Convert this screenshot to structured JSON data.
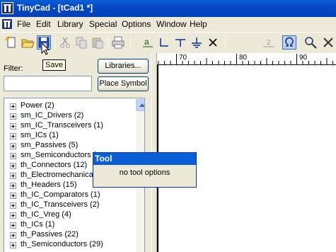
{
  "window": {
    "title": "TinyCad - [tCad1 *]"
  },
  "menu": {
    "items": [
      "File",
      "Edit",
      "Library",
      "Special",
      "Options",
      "Window",
      "Help"
    ]
  },
  "toolbar": {
    "tooltip": "Save",
    "text_tool_label": "a",
    "pin_tool_label": "2",
    "buttons": [
      "new-icon",
      "open-icon",
      "save-icon",
      "cut-icon",
      "copy-icon",
      "paste-icon",
      "print-icon",
      "text-icon",
      "wire-icon",
      "power-icon",
      "ground-icon",
      "no-connect-icon",
      "pin-icon",
      "omega-icon",
      "zoom-icon",
      "delete-icon"
    ]
  },
  "library_panel": {
    "filter_label": "Filter:",
    "filter_value": "",
    "libraries_button": "Libraries...",
    "place_symbol_button": "Place Symbol",
    "tree_items": [
      "Power (2)",
      "sm_IC_Drivers (2)",
      "sm_IC_Transceivers (1)",
      "sm_ICs (1)",
      "sm_Passives (5)",
      "sm_Semiconductors (",
      "th_Connectors (12)",
      "th_Electromechanical",
      "th_Headers (15)",
      "th_IC_Comparators (1)",
      "th_IC_Transceivers (2)",
      "th_IC_Vreg (4)",
      "th_ICs (1)",
      "th_Passives (22)",
      "th_Semiconductors (29)"
    ]
  },
  "ruler": {
    "labels": [
      "70",
      "80",
      "90"
    ]
  },
  "tool_popup": {
    "title": "Tool",
    "message": "no tool options"
  },
  "colors": {
    "titlebar": "#0548c8",
    "face": "#ece9d8",
    "popup_border": "#0831d9"
  }
}
